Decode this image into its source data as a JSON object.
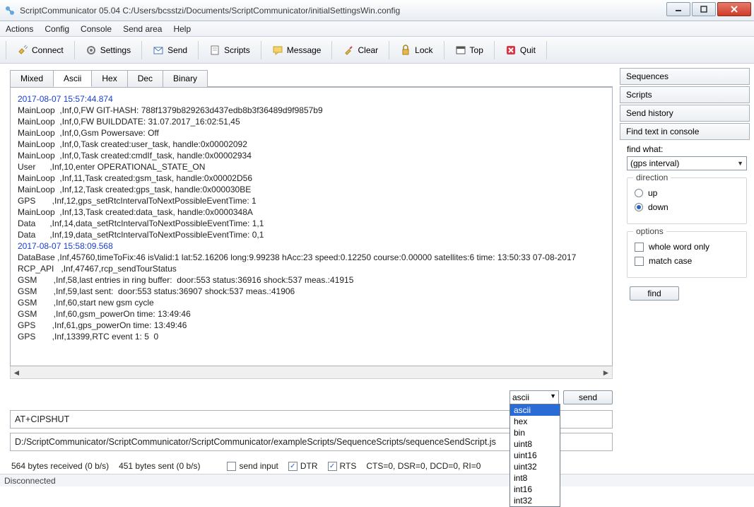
{
  "title": "ScriptCommunicator 05.04   C:/Users/bcsstzi/Documents/ScriptCommunicator/initialSettingsWin.config",
  "menu": {
    "items": [
      "Actions",
      "Config",
      "Console",
      "Send area",
      "Help"
    ]
  },
  "toolbar": {
    "connect": "Connect",
    "settings": "Settings",
    "send": "Send",
    "scripts": "Scripts",
    "message": "Message",
    "clear": "Clear",
    "lock": "Lock",
    "top": "Top",
    "quit": "Quit"
  },
  "tabs": [
    "Mixed",
    "Ascii",
    "Hex",
    "Dec",
    "Binary"
  ],
  "active_tab": "Ascii",
  "console": {
    "ts1": "2017-08-07 15:57:44.874",
    "l1": "MainLoop  ,Inf,0,FW GIT-HASH: 788f1379b829263d437edb8b3f36489d9f9857b9",
    "l2": "MainLoop  ,Inf,0,FW BUILDDATE: 31.07.2017_16:02:51,45",
    "l3": "MainLoop  ,Inf,0,Gsm Powersave: Off",
    "l4": "MainLoop  ,Inf,0,Task created:user_task, handle:0x00002092",
    "l5": "MainLoop  ,Inf,0,Task created:cmdIf_task, handle:0x00002934",
    "l6": "User      ,Inf,10,enter OPERATIONAL_STATE_ON",
    "l7": "MainLoop  ,Inf,11,Task created:gsm_task, handle:0x00002D56",
    "l8": "MainLoop  ,Inf,12,Task created:gps_task, handle:0x000030BE",
    "l9": "GPS       ,Inf,12,gps_setRtcIntervalToNextPossibleEventTime: 1",
    "l10": "MainLoop  ,Inf,13,Task created:data_task, handle:0x0000348A",
    "l11": "Data      ,Inf,14,data_setRtcIntervalToNextPossibleEventTime: 1,1",
    "l12": "Data      ,Inf,19,data_setRtcIntervalToNextPossibleEventTime: 0,1",
    "ts2": "2017-08-07 15:58:09.568",
    "l13": "DataBase  ,Inf,45760,timeToFix:46 isValid:1 lat:52.16206 long:9.99238 hAcc:23 speed:0.12250 course:0.00000 satellites:6 time: 13:50:33 07-08-2017",
    "l14": "RCP_API   ,Inf,47467,rcp_sendTourStatus",
    "l15": "GSM       ,Inf,58,last entries in ring buffer:  door:553 status:36916 shock:537 meas.:41915",
    "l16": "GSM       ,Inf,59,last sent:  door:553 status:36907 shock:537 meas.:41906",
    "l17": "GSM       ,Inf,60,start new gsm cycle",
    "l18": "GSM       ,Inf,60,gsm_powerOn time: 13:49:46",
    "l19": "GPS       ,Inf,61,gps_powerOn time: 13:49:46",
    "l20": "GPS       ,Inf,13399,RTC event 1: 5  0"
  },
  "send_format": {
    "selected": "ascii",
    "options": [
      "ascii",
      "hex",
      "bin",
      "uint8",
      "uint16",
      "uint32",
      "int8",
      "int16",
      "int32"
    ]
  },
  "send_button": "send",
  "input_text": "AT+CIPSHUT",
  "script_path": "D:/ScriptCommunicator/ScriptCommunicator/ScriptCommunicator/exampleScripts/SequenceScripts/sequenceSendScript.js",
  "stats": {
    "received": "564 bytes received (0 b/s)",
    "sent": "451 bytes sent (0 b/s)"
  },
  "checks": {
    "send_input": "send input",
    "dtr": "DTR",
    "rts": "RTS",
    "signal": "CTS=0, DSR=0, DCD=0, RI=0",
    "dtr_checked": true,
    "rts_checked": true,
    "send_input_checked": false
  },
  "right": {
    "acc": [
      "Sequences",
      "Scripts",
      "Send history",
      "Find text in console"
    ],
    "find_label": "find what:",
    "find_value": "(gps interval)",
    "direction_label": "direction",
    "up": "up",
    "down": "down",
    "dir_selected": "down",
    "options_label": "options",
    "whole": "whole word only",
    "match": "match case",
    "find_button": "find"
  },
  "statusbar": "Disconnected"
}
